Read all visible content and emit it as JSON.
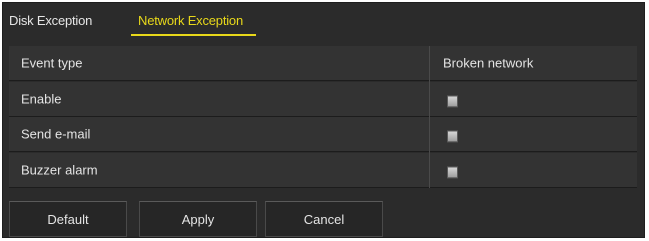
{
  "tabs": [
    {
      "label": "Disk Exception",
      "active": false
    },
    {
      "label": "Network Exception",
      "active": true
    }
  ],
  "table": {
    "header": {
      "label": "Event type",
      "column": "Broken network"
    },
    "rows": [
      {
        "label": "Enable",
        "checked": false
      },
      {
        "label": "Send e-mail",
        "checked": false
      },
      {
        "label": "Buzzer alarm",
        "checked": false
      }
    ]
  },
  "buttons": {
    "default": "Default",
    "apply": "Apply",
    "cancel": "Cancel"
  },
  "colors": {
    "accent": "#e8d81a",
    "panel": "#2b2b2b",
    "row": "#333333",
    "text": "#e4e4e4"
  }
}
